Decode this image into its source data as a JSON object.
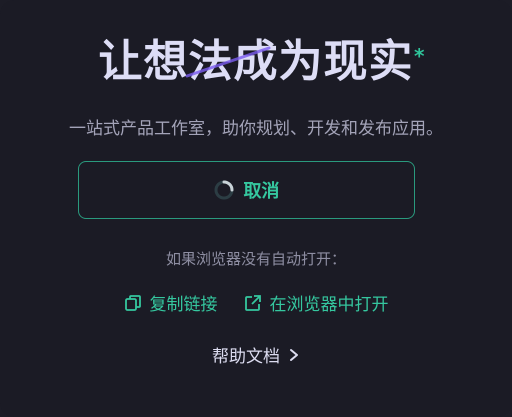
{
  "title": "让想法成为现实",
  "title_accent": "*",
  "subtitle": "一站式产品工作室，助你规划、开发和发布应用。",
  "cancel_button": {
    "label": "取消",
    "icon": "spinner-icon"
  },
  "hint": "如果浏览器没有自动打开：",
  "links": {
    "copy": {
      "label": "复制链接",
      "icon": "copy-icon"
    },
    "open_browser": {
      "label": "在浏览器中打开",
      "icon": "external-link-icon"
    }
  },
  "help": {
    "label": "帮助文档",
    "icon": "chevron-right-icon"
  },
  "colors": {
    "background": "#1b1b25",
    "accent": "#35c79f",
    "title": "#ddddf6",
    "subtitle": "#a3a3b8"
  }
}
